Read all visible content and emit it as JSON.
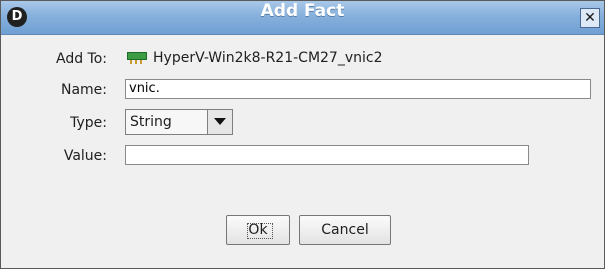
{
  "dialog": {
    "title": "Add Fact",
    "app_icon_letter": "D",
    "close_glyph": "✕"
  },
  "form": {
    "add_to_label": "Add To:",
    "add_to_value": "HyperV-Win2k8-R21-CM27_vnic2",
    "add_to_icon": "network-card-icon",
    "name_label": "Name:",
    "name_value": "vnic.",
    "type_label": "Type:",
    "type_value": "String",
    "value_label": "Value:",
    "value_value": ""
  },
  "buttons": {
    "ok": "Ok",
    "cancel": "Cancel"
  }
}
